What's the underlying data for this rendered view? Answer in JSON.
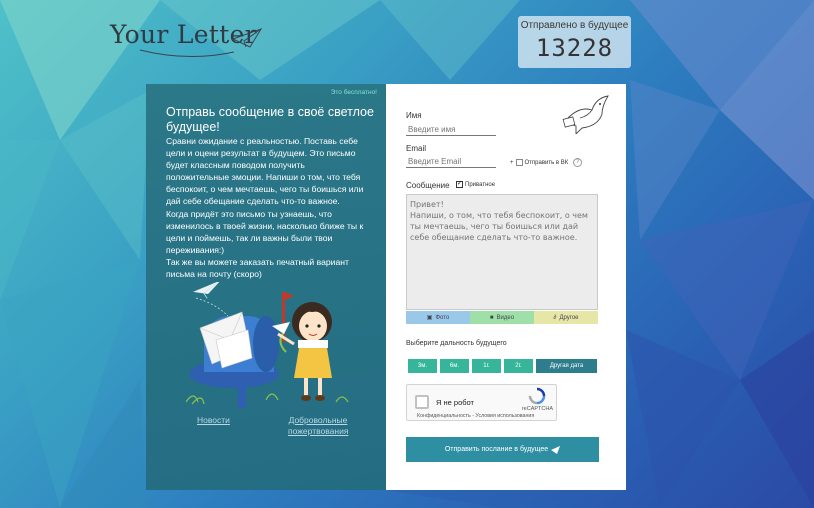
{
  "brand": {
    "logo_text": "Your Letter"
  },
  "counter": {
    "label": "Отправлено в будущее",
    "value": "13228"
  },
  "info": {
    "free_badge": "Это бесплатно!",
    "title": "Отправь сообщение в своё светлое будущее!",
    "body": "Сравни ожидание с реальностью. Поставь себе цели и оцени результат в будущем. Это письмо будет классным поводом получить положительные эмоции. Напиши о том, что тебя беспокоит, о чем мечтаешь, чего ты боишься или дай себе обещание сделать что-то важное.\nКогда придёт это письмо ты узнаешь, что изменилось в твоей жизни, насколько ближе ты к цели и поймешь, так ли важны были твои переживания:)\nТак же вы можете заказать печатный вариант письма на почту (скоро)",
    "link_news": "Новости",
    "link_donate": "Добровольные пожертвования"
  },
  "form": {
    "name_label": "Имя",
    "name_placeholder": "Введите имя",
    "email_label": "Email",
    "email_placeholder": "Введите Email",
    "vk_plus": "+",
    "vk_label": "Отправить в ВК",
    "help_mark": "?",
    "message_label": "Сообщение",
    "private_label": "Приватное",
    "message_placeholder": "Привет!\nНапиши, о том, что тебя беспокоит, о чем ты мечтаешь, чего ты боишься или дай себе обещание сделать что-то важное.",
    "attach_photo": "Фото",
    "attach_video": "Видео",
    "attach_other": "Другое",
    "distance_label": "Выберите дальность будущего",
    "distances": [
      "3м.",
      "6м.",
      "1г.",
      "2г.",
      "Другая дата"
    ],
    "captcha_label": "Я не робот",
    "captcha_brand": "reCAPTCHA",
    "captcha_privacy": "Конфиденциальность - Условия использования",
    "submit_label": "Отправить послание в будущее"
  },
  "colors": {
    "left_panel": "#2a7686",
    "distance_button": "#37b59b",
    "distance_button_selected": "#2d7d8c",
    "submit": "#2e8fa2",
    "attach_photo": "#9ac8e8",
    "attach_video": "#9ee0a7",
    "attach_other": "#e6e7a6"
  }
}
